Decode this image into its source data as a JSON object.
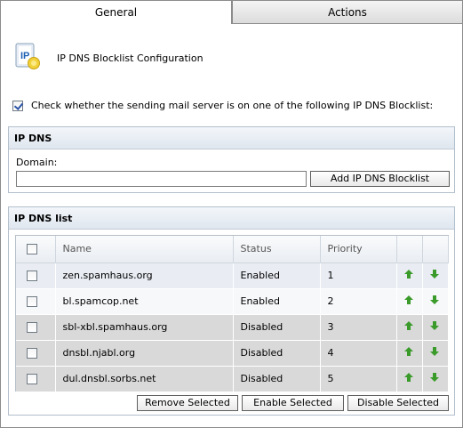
{
  "tabs": [
    {
      "label": "General",
      "active": true
    },
    {
      "label": "Actions",
      "active": false
    }
  ],
  "header": {
    "title": "IP DNS Blocklist Configuration",
    "icon": "ip-config-icon"
  },
  "check_option": {
    "label": "Check whether the sending mail server is on one of the following IP DNS Blocklist:",
    "checked": true
  },
  "dns_panel": {
    "title": "IP DNS",
    "domain_label": "Domain:",
    "domain_value": "",
    "add_button": "Add IP DNS Blocklist"
  },
  "list_panel": {
    "title": "IP DNS list",
    "columns": {
      "name": "Name",
      "status": "Status",
      "priority": "Priority"
    },
    "rows": [
      {
        "name": "zen.spamhaus.org",
        "status": "Enabled",
        "priority": "1"
      },
      {
        "name": "bl.spamcop.net",
        "status": "Enabled",
        "priority": "2"
      },
      {
        "name": "sbl-xbl.spamhaus.org",
        "status": "Disabled",
        "priority": "3"
      },
      {
        "name": "dnsbl.njabl.org",
        "status": "Disabled",
        "priority": "4"
      },
      {
        "name": "dul.dnsbl.sorbs.net",
        "status": "Disabled",
        "priority": "5"
      }
    ],
    "buttons": {
      "remove": "Remove Selected",
      "enable": "Enable Selected",
      "disable": "Disable Selected"
    }
  },
  "colors": {
    "arrow_green": "#3a9a2a",
    "panel_border": "#b3bfcc",
    "disabled_row": "#d9d9d9"
  }
}
